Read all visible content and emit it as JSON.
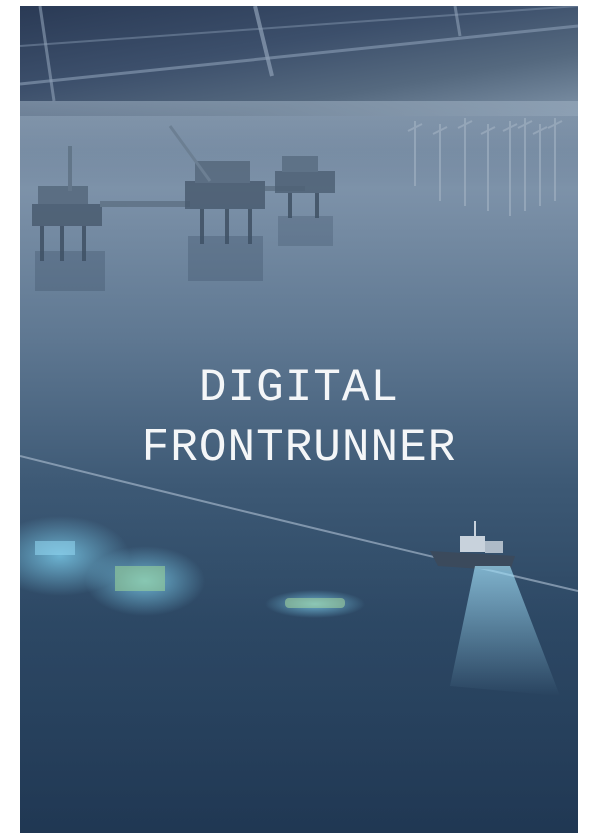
{
  "cover": {
    "title_line1": "DIGITAL",
    "title_line2": "FRONTRUNNER"
  },
  "colors": {
    "sea_dark": "#223a56",
    "sea_mid": "#5f7892",
    "horizon": "#7d92a9",
    "title_text": "#f4f6f8",
    "subsea_glow": "#6fc3e8"
  },
  "icons": [
    "oil-platform-icon",
    "wind-turbine-icon",
    "vessel-icon",
    "subsea-module-icon"
  ]
}
